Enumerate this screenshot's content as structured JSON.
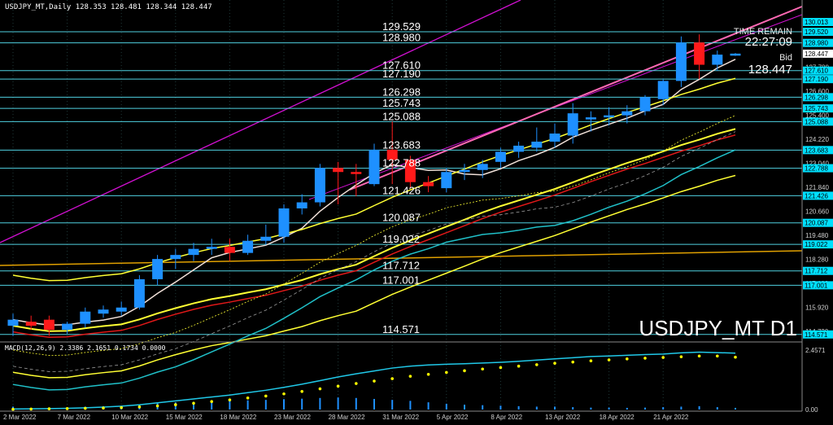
{
  "window": {
    "header": "USDJPY_MT,Daily  128.353 128.481 128.344 128.447",
    "symbol_watermark": "USDJPY_MT D1",
    "time_remain_label": "TIME REMAIN",
    "time_remain_value": "22:27:09",
    "bid_label": "Bid",
    "bid_value": "128.447",
    "macd_header": "MACD(12,26,9) 2.3386 2.1651 0.1734 0.0000"
  },
  "colors": {
    "background": "#000000",
    "grid": "#1f3a3a",
    "bull": "#1e90ff",
    "bear": "#ff1a1a",
    "level_line": "#4fd1e0",
    "level_badge": "#00e0ff",
    "bb": "#ffff33",
    "ma_red": "#e01818",
    "ma_cyan": "#20c0c8",
    "ma_white": "#f0e0d8",
    "ma_orange": "#e0a000",
    "channel": "#d010d0",
    "trend_pink": "#ff69b4",
    "ichimoku": "#9a9a9a",
    "macd_line": "#20c8e8",
    "macd_signal": "#ffff00",
    "macd_hist": "#1e90ff"
  },
  "chart_data": [
    {
      "type": "candlestick",
      "symbol": "USDJPY_MT",
      "timeframe": "Daily",
      "ylim": [
        114.2,
        131.1
      ],
      "x_tick_labels": [
        "2 Mar 2022",
        "7 Mar 2022",
        "10 Mar 2022",
        "15 Mar 2022",
        "18 Mar 2022",
        "23 Mar 2022",
        "28 Mar 2022",
        "31 Mar 2022",
        "5 Apr 2022",
        "8 Apr 2022",
        "13 Apr 2022",
        "18 Apr 2022",
        "21 Apr 2022"
      ],
      "x_tick_bars": [
        0,
        3,
        6,
        9,
        12,
        15,
        18,
        21,
        24,
        27,
        30,
        33,
        36
      ],
      "y_tick_labels": [
        "130.010",
        "128.980",
        "127.780",
        "127.190",
        "126.600",
        "125.400",
        "124.220",
        "123.040",
        "121.840",
        "120.660",
        "119.480",
        "118.280",
        "117.100",
        "115.920",
        "114.730"
      ],
      "candles": [
        {
          "o": 115.0,
          "h": 115.6,
          "l": 114.5,
          "c": 115.3
        },
        {
          "o": 115.2,
          "h": 115.5,
          "l": 114.8,
          "c": 115.0
        },
        {
          "o": 115.3,
          "h": 115.5,
          "l": 114.5,
          "c": 114.8
        },
        {
          "o": 114.8,
          "h": 115.2,
          "l": 114.6,
          "c": 115.1
        },
        {
          "o": 115.1,
          "h": 115.9,
          "l": 114.9,
          "c": 115.7
        },
        {
          "o": 115.6,
          "h": 116.0,
          "l": 115.4,
          "c": 115.8
        },
        {
          "o": 115.7,
          "h": 116.2,
          "l": 115.5,
          "c": 115.9
        },
        {
          "o": 115.9,
          "h": 117.5,
          "l": 115.8,
          "c": 117.3
        },
        {
          "o": 117.3,
          "h": 118.5,
          "l": 117.0,
          "c": 118.3
        },
        {
          "o": 118.3,
          "h": 118.8,
          "l": 117.8,
          "c": 118.5
        },
        {
          "o": 118.5,
          "h": 119.1,
          "l": 118.2,
          "c": 118.8
        },
        {
          "o": 118.8,
          "h": 119.3,
          "l": 118.5,
          "c": 118.9
        },
        {
          "o": 118.9,
          "h": 119.3,
          "l": 118.2,
          "c": 118.6
        },
        {
          "o": 118.6,
          "h": 119.5,
          "l": 118.5,
          "c": 119.2
        },
        {
          "o": 119.2,
          "h": 120.0,
          "l": 119.0,
          "c": 119.4
        },
        {
          "o": 119.4,
          "h": 121.0,
          "l": 119.1,
          "c": 120.8
        },
        {
          "o": 120.8,
          "h": 121.5,
          "l": 120.5,
          "c": 121.1
        },
        {
          "o": 121.1,
          "h": 123.0,
          "l": 120.9,
          "c": 122.8
        },
        {
          "o": 122.8,
          "h": 123.1,
          "l": 121.0,
          "c": 122.6
        },
        {
          "o": 122.6,
          "h": 123.0,
          "l": 121.4,
          "c": 122.5
        },
        {
          "o": 122.0,
          "h": 124.0,
          "l": 121.9,
          "c": 123.7
        },
        {
          "o": 123.7,
          "h": 125.1,
          "l": 122.0,
          "c": 123.2
        },
        {
          "o": 123.2,
          "h": 123.4,
          "l": 121.8,
          "c": 122.1
        },
        {
          "o": 122.1,
          "h": 122.4,
          "l": 121.6,
          "c": 121.9
        },
        {
          "o": 121.8,
          "h": 122.8,
          "l": 121.6,
          "c": 122.6
        },
        {
          "o": 122.6,
          "h": 123.0,
          "l": 122.2,
          "c": 122.7
        },
        {
          "o": 122.7,
          "h": 123.2,
          "l": 122.3,
          "c": 123.0
        },
        {
          "o": 123.1,
          "h": 123.8,
          "l": 122.8,
          "c": 123.6
        },
        {
          "o": 123.6,
          "h": 124.1,
          "l": 123.3,
          "c": 123.9
        },
        {
          "o": 123.8,
          "h": 124.8,
          "l": 123.6,
          "c": 124.1
        },
        {
          "o": 124.1,
          "h": 125.0,
          "l": 123.8,
          "c": 124.5
        },
        {
          "o": 124.4,
          "h": 126.0,
          "l": 124.0,
          "c": 125.5
        },
        {
          "o": 125.2,
          "h": 125.6,
          "l": 124.6,
          "c": 125.3
        },
        {
          "o": 125.3,
          "h": 125.8,
          "l": 124.9,
          "c": 125.4
        },
        {
          "o": 125.4,
          "h": 125.9,
          "l": 125.0,
          "c": 125.6
        },
        {
          "o": 125.6,
          "h": 126.4,
          "l": 125.4,
          "c": 126.3
        },
        {
          "o": 126.2,
          "h": 127.2,
          "l": 125.9,
          "c": 127.1
        },
        {
          "o": 127.1,
          "h": 129.3,
          "l": 126.8,
          "c": 129.0
        },
        {
          "o": 129.0,
          "h": 129.4,
          "l": 127.2,
          "c": 127.9
        },
        {
          "o": 127.9,
          "h": 128.6,
          "l": 127.6,
          "c": 128.4
        },
        {
          "o": 128.35,
          "h": 128.48,
          "l": 128.34,
          "c": 128.45
        }
      ],
      "levels": [
        {
          "price": 129.529,
          "label": "129.529",
          "badge": "129.520"
        },
        {
          "price": 128.98,
          "label": "128.980",
          "badge": "128.980"
        },
        {
          "price": 127.61,
          "label": "127.610",
          "badge": "127.610"
        },
        {
          "price": 127.19,
          "label": "127.190",
          "badge": "127.190"
        },
        {
          "price": 126.298,
          "label": "126.298",
          "badge": "126.298"
        },
        {
          "price": 125.743,
          "label": "125.743",
          "badge": "125.743"
        },
        {
          "price": 125.088,
          "label": "125.088",
          "badge": "125.088"
        },
        {
          "price": 123.683,
          "label": "123.683",
          "badge": "123.683"
        },
        {
          "price": 122.788,
          "label": "122.788",
          "badge": "122.788"
        },
        {
          "price": 121.426,
          "label": "121.426",
          "badge": "121.426"
        },
        {
          "price": 120.087,
          "label": "120.087",
          "badge": "120.087"
        },
        {
          "price": 119.022,
          "label": "119.022",
          "badge": "119.022"
        },
        {
          "price": 117.712,
          "label": "117.712",
          "badge": "117.712"
        },
        {
          "price": 117.001,
          "label": "117.001",
          "badge": "117.001"
        },
        {
          "price": 114.571,
          "label": "114.571",
          "badge": "114.571"
        }
      ],
      "top_badge": "130.013",
      "current_price_badge": "128.447"
    },
    {
      "type": "macd",
      "params": "12,26,9",
      "y_tick_labels": [
        "2.4571",
        "0.00"
      ],
      "ylim": [
        0,
        2.6
      ],
      "macd_line": [
        0.02,
        0.03,
        0.04,
        0.05,
        0.07,
        0.1,
        0.14,
        0.2,
        0.28,
        0.36,
        0.44,
        0.52,
        0.6,
        0.7,
        0.8,
        0.92,
        1.05,
        1.2,
        1.35,
        1.48,
        1.6,
        1.72,
        1.8,
        1.85,
        1.88,
        1.9,
        1.93,
        1.96,
        2.0,
        2.05,
        2.1,
        2.15,
        2.2,
        2.22,
        2.25,
        2.28,
        2.3,
        2.35,
        2.38,
        2.36,
        2.34
      ],
      "signal_line": [
        0.01,
        0.02,
        0.03,
        0.04,
        0.05,
        0.06,
        0.08,
        0.11,
        0.15,
        0.2,
        0.26,
        0.33,
        0.4,
        0.48,
        0.56,
        0.65,
        0.75,
        0.86,
        0.97,
        1.08,
        1.18,
        1.28,
        1.38,
        1.46,
        1.54,
        1.61,
        1.68,
        1.74,
        1.8,
        1.86,
        1.92,
        1.97,
        2.02,
        2.06,
        2.1,
        2.13,
        2.16,
        2.19,
        2.22,
        2.22,
        2.17
      ],
      "histogram": [
        0.12,
        0.05,
        0.05,
        0.08,
        0.12,
        0.14,
        0.16,
        0.2,
        0.27,
        0.3,
        0.32,
        0.34,
        0.36,
        0.38,
        0.4,
        0.43,
        0.45,
        0.48,
        0.5,
        0.48,
        0.44,
        0.4,
        0.36,
        0.3,
        0.24,
        0.2,
        0.18,
        0.16,
        0.14,
        0.12,
        0.12,
        0.1,
        0.08,
        0.08,
        0.07,
        0.08,
        0.1,
        0.12,
        0.14,
        0.1,
        0.07
      ]
    }
  ]
}
